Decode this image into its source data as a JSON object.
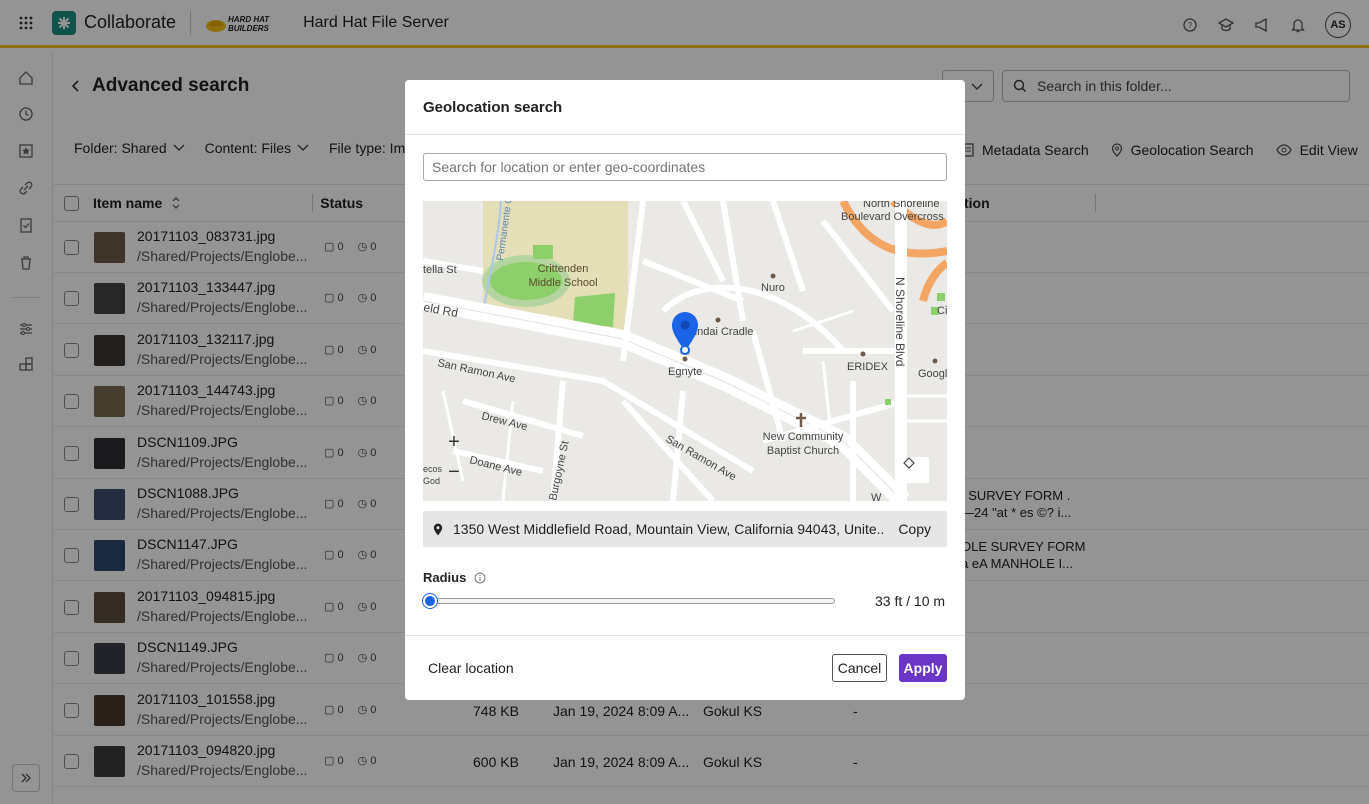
{
  "colors": {
    "accent": "#6b35c7",
    "brand": "#1c8f80",
    "topbar_border": "#f4c21a",
    "pin": "#1a64e8"
  },
  "app": {
    "name": "Collaborate",
    "server_title": "Hard Hat File Server",
    "partner_logo_text": "HARD HAT BUILDERS",
    "user_initials": "AS"
  },
  "page": {
    "title": "Advanced search",
    "search_placeholder": "Search in this folder..."
  },
  "filters": [
    {
      "label": "Folder: Shared"
    },
    {
      "label": "Content: Files"
    },
    {
      "label": "File type: Im"
    }
  ],
  "actions": {
    "metadata": "Metadata Search",
    "geolocation": "Geolocation Search",
    "edit_view": "Edit View"
  },
  "columns": {
    "item_name": "Item name",
    "status": "Status",
    "description_partial": "tion"
  },
  "rows": [
    {
      "name": "20171103_083731.jpg",
      "path": "/Shared/Projects/Englobe...",
      "comments": "0",
      "versions": "0",
      "size": "",
      "date": "",
      "by": "",
      "dash": "",
      "desc1": "",
      "desc2": "",
      "thumb": "#6b5a48"
    },
    {
      "name": "20171103_133447.jpg",
      "path": "/Shared/Projects/Englobe...",
      "comments": "0",
      "versions": "0",
      "size": "",
      "date": "",
      "by": "",
      "dash": "",
      "desc1": "",
      "desc2": "",
      "thumb": "#444444"
    },
    {
      "name": "20171103_132117.jpg",
      "path": "/Shared/Projects/Englobe...",
      "comments": "0",
      "versions": "0",
      "size": "",
      "date": "",
      "by": "",
      "dash": "",
      "desc1": "",
      "desc2": "",
      "thumb": "#3b3632"
    },
    {
      "name": "20171103_144743.jpg",
      "path": "/Shared/Projects/Englobe...",
      "comments": "0",
      "versions": "0",
      "size": "",
      "date": "",
      "by": "",
      "dash": "",
      "desc1": "",
      "desc2": "",
      "thumb": "#7a6a52"
    },
    {
      "name": "DSCN1109.JPG",
      "path": "/Shared/Projects/Englobe...",
      "comments": "0",
      "versions": "0",
      "size": "",
      "date": "",
      "by": "",
      "dash": "",
      "desc1": "",
      "desc2": "",
      "thumb": "#2e2e32"
    },
    {
      "name": "DSCN1088.JPG",
      "path": "/Shared/Projects/Englobe...",
      "comments": "0",
      "versions": "0",
      "size": "",
      "date": "",
      "by": "",
      "dash": "",
      "desc1": "f SURVEY FORM .",
      "desc2": "—24 \"at * es ©? i...",
      "thumb": "#3e4f6e"
    },
    {
      "name": "DSCN1147.JPG",
      "path": "/Shared/Projects/Englobe...",
      "comments": "0",
      "versions": "0",
      "size": "",
      "date": "",
      "by": "",
      "dash": "",
      "desc1": "OLE SURVEY FORM",
      "desc2": "a eA MANHOLE I...",
      "thumb": "#30476d"
    },
    {
      "name": "20171103_094815.jpg",
      "path": "/Shared/Projects/Englobe...",
      "comments": "0",
      "versions": "0",
      "size": "",
      "date": "",
      "by": "",
      "dash": "",
      "desc1": "",
      "desc2": "",
      "thumb": "#5a4a3c"
    },
    {
      "name": "DSCN1149.JPG",
      "path": "/Shared/Projects/Englobe...",
      "comments": "0",
      "versions": "0",
      "size": "",
      "date": "",
      "by": "",
      "dash": "",
      "desc1": "",
      "desc2": "",
      "thumb": "#3a3d47"
    },
    {
      "name": "20171103_101558.jpg",
      "path": "/Shared/Projects/Englobe...",
      "comments": "0",
      "versions": "0",
      "size": "748 KB",
      "date": "Jan 19, 2024 8:09 A...",
      "by": "Gokul KS",
      "dash": "-",
      "desc1": "",
      "desc2": "",
      "thumb": "#4a3a30"
    },
    {
      "name": "20171103_094820.jpg",
      "path": "/Shared/Projects/Englobe...",
      "comments": "0",
      "versions": "0",
      "size": "600 KB",
      "date": "Jan 19, 2024 8:09 A...",
      "by": "Gokul KS",
      "dash": "-",
      "desc1": "",
      "desc2": "",
      "thumb": "#3c3c3c"
    }
  ],
  "modal": {
    "title": "Geolocation search",
    "search_placeholder": "Search for location or enter geo-coordinates",
    "map_labels": {
      "school": "Crittenden",
      "school2": "Middle School",
      "creek": "Permanente Creek",
      "stella": "tella St",
      "field": "eld Rd",
      "san_ramon1": "San Ramon Ave",
      "san_ramon2": "San Ramon Ave",
      "drew": "Drew Ave",
      "doane": "Doane Ave",
      "burgoyne": "Burgoyne St",
      "nuro": "Nuro",
      "cradle": "undai Cradle",
      "egnyte": "Egnyte",
      "eridex": "ERIDEX",
      "church1": "New Community",
      "church2": "Baptist Church",
      "shoreline": "N Shoreline Blvd",
      "overcross1": "North Shoreline",
      "overcross2": "Boulevard Overcross",
      "google": "Googl",
      "ecos1": "ecos",
      "ecos2": "God",
      "ci": "Ci",
      "w": "W"
    },
    "address": "1350 West Middlefield Road, Mountain View, California 94043, Unite...",
    "copy_label": "Copy",
    "radius_label": "Radius",
    "radius_value": "33 ft / 10 m",
    "radius_fraction": 0,
    "clear_label": "Clear location",
    "cancel_label": "Cancel",
    "apply_label": "Apply"
  }
}
